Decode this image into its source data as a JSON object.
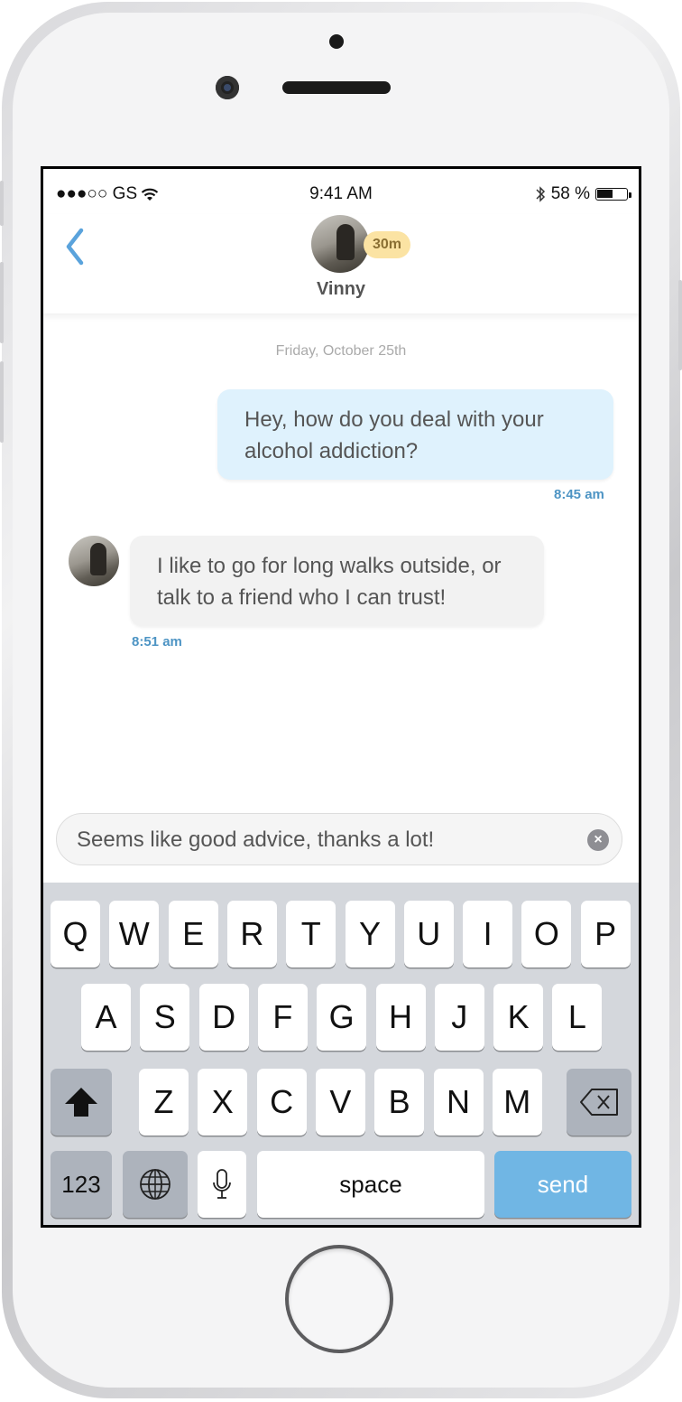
{
  "status_bar": {
    "carrier": "●●●○○ GS",
    "time": "9:41 AM",
    "battery_percent": "58 %",
    "battery_level": 0.58
  },
  "header": {
    "contact_name": "Vinny",
    "badge": "30m",
    "back_icon": "chevron-left-icon"
  },
  "conversation": {
    "date": "Friday, October 25th",
    "messages": [
      {
        "direction": "outgoing",
        "text": "Hey, how do you deal with your alcohol addiction?",
        "time": "8:45 am"
      },
      {
        "direction": "incoming",
        "text": "I like to go for long walks outside, or talk to a friend who I can trust!",
        "time": "8:51 am"
      }
    ]
  },
  "compose": {
    "value": "Seems like good advice, thanks a lot!",
    "clear_icon": "clear-icon"
  },
  "keyboard": {
    "row1": [
      "Q",
      "W",
      "E",
      "R",
      "T",
      "Y",
      "U",
      "I",
      "O",
      "P"
    ],
    "row2": [
      "A",
      "S",
      "D",
      "F",
      "G",
      "H",
      "J",
      "K",
      "L"
    ],
    "row3": [
      "Z",
      "X",
      "C",
      "V",
      "B",
      "N",
      "M"
    ],
    "numbers_label": "123",
    "space_label": "space",
    "send_label": "send"
  },
  "colors": {
    "accent": "#5aa3dc",
    "outgoing_bubble": "#dff2fd",
    "incoming_bubble": "#f2f2f2",
    "badge": "#fbe3a3",
    "send_key": "#70b6e4"
  }
}
